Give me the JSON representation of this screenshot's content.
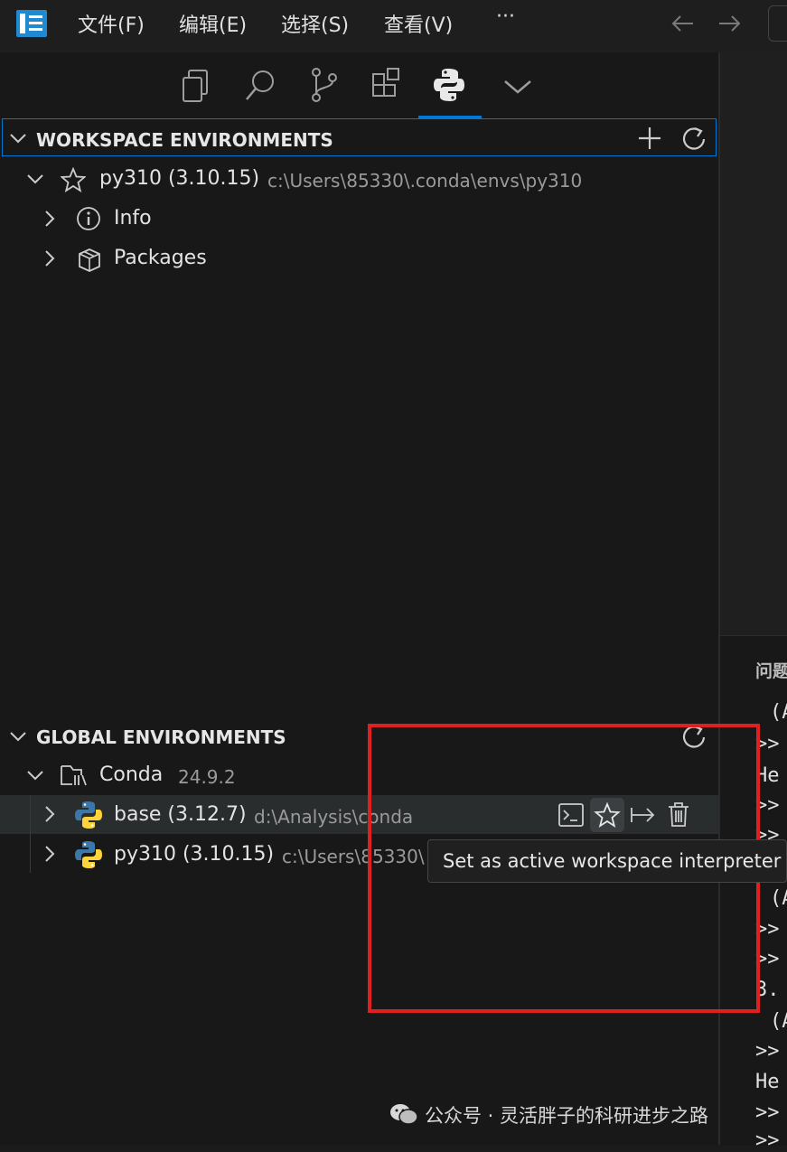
{
  "menu": {
    "items": [
      "文件(F)",
      "编辑(E)",
      "选择(S)",
      "查看(V)",
      "···"
    ]
  },
  "activity_bar": {
    "icons": [
      "explorer-icon",
      "search-icon",
      "source-control-icon",
      "extensions-icon",
      "python-icon",
      "chevron-down-icon"
    ],
    "active": "python-icon"
  },
  "workspace_section": {
    "title": "WORKSPACE ENVIRONMENTS",
    "env": {
      "name": "py310 (3.10.15)",
      "path": "c:\\Users\\85330\\.conda\\envs\\py310"
    },
    "children": [
      "Info",
      "Packages"
    ]
  },
  "global_section": {
    "title": "GLOBAL ENVIRONMENTS",
    "manager": {
      "name": "Conda",
      "version": "24.9.2"
    },
    "envs": [
      {
        "name": "base (3.12.7)",
        "path": "d:\\Analysis\\conda"
      },
      {
        "name": "py310 (3.10.15)",
        "path": "c:\\Users\\85330\\"
      }
    ]
  },
  "tooltip": {
    "text": "Set as active workspace interpreter"
  },
  "panel": {
    "title": "问题",
    "lines": [
      "(A",
      ">>",
      "He",
      ">>",
      ">>",
      "(A",
      ">>",
      ">>",
      "3.",
      "(A",
      ">>",
      "He",
      ">>",
      ">>"
    ]
  },
  "watermark": {
    "text": "公众号 · 灵活胖子的科研进步之路"
  },
  "colors": {
    "accent": "#0078d4",
    "highlight_box": "#e0201f",
    "python_blue": "#3b77a8",
    "python_yellow": "#ffd43b"
  }
}
